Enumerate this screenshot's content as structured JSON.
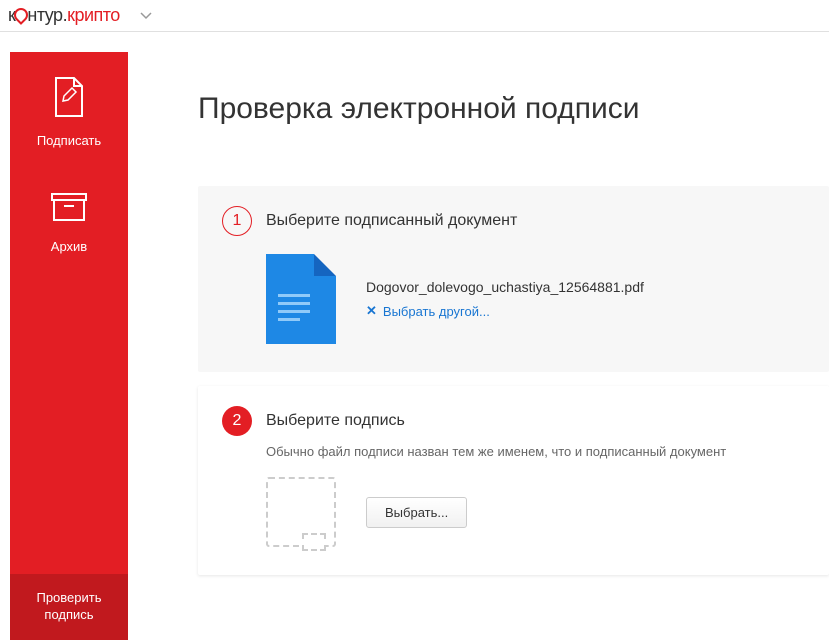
{
  "logo": {
    "part1": "к",
    "part2": "нтур.",
    "part3": "крипто"
  },
  "sidebar": {
    "items": [
      {
        "label": "Подписать"
      },
      {
        "label": "Архив"
      }
    ],
    "active": {
      "label": "Проверить подпись"
    }
  },
  "page": {
    "title": "Проверка электронной подписи"
  },
  "step1": {
    "number": "1",
    "title": "Выберите подписанный документ",
    "file_name": "Dogovor_dolevogo_uchastiya_12564881.pdf",
    "choose_another": "Выбрать другой..."
  },
  "step2": {
    "number": "2",
    "title": "Выберите подпись",
    "subtitle": "Обычно файл подписи назван тем же именем, что и подписанный документ",
    "choose_button": "Выбрать..."
  }
}
